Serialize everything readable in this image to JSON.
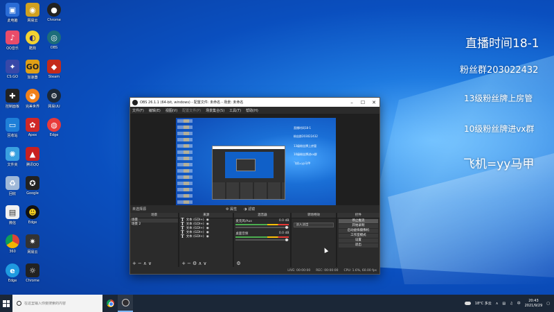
{
  "overlay": {
    "line1": "直播时间18-1",
    "line2": "粉丝群203022432",
    "line3": "13级粉丝牌上房管",
    "line4": "10级粉丝牌进vx群",
    "line5": "飞机=yy马甲"
  },
  "obs": {
    "title": "OBS 26.1.1 (64-bit, windows) - 配置文件: 未命名 - 场景: 未命名",
    "menu": [
      "文件(F)",
      "编辑(E)",
      "视图(V)",
      "配置文件(P)",
      "场景集合(S)",
      "工具(T)",
      "帮助(H)"
    ],
    "no_source": "未选择源",
    "properties": "属性",
    "filters": "滤镜",
    "docks": {
      "scenes": "场景",
      "sources": "来源",
      "mixer": "混音器",
      "transitions": "转场特效",
      "controls": "控件"
    },
    "scenes": [
      "场景",
      "场景 2"
    ],
    "sources": [
      "文本 (GDI+)",
      "文本 (GDI+)",
      "文本 (GDI+)",
      "文本 (GDI+)",
      "文本 (GDI+)"
    ],
    "mixer": [
      {
        "name": "麦克风/Aux",
        "db": "0.0 dB"
      },
      {
        "name": "桌面音频",
        "db": "0.0 dB"
      }
    ],
    "transition": "淡入淡出",
    "controls": [
      "停止推流",
      "开始录制",
      "启动虚拟摄像机",
      "工作室模式",
      "设置",
      "退出"
    ],
    "status": [
      "LIVE: 00:00:00",
      "REC: 00:00:00",
      "CPU: 1.6%, 60.00 fps"
    ]
  },
  "taskbar": {
    "search_placeholder": "在这里输入你要搜索的内容",
    "weather": "18°C 多云",
    "time": "20:43",
    "date": "2021/9/29"
  },
  "desktop_icons": [
    "此电脑",
    "网易云",
    "Chrome",
    "QQ音乐",
    "酷狗",
    "OBS",
    "CS:GO",
    "加速器",
    "Steam",
    "控制面板",
    "完美世界",
    "网易UU",
    "回收站",
    "Apex",
    "Edge",
    "文件夹",
    "腾讯QQ",
    "回收",
    "Google",
    "微信",
    "Edge",
    "360"
  ]
}
